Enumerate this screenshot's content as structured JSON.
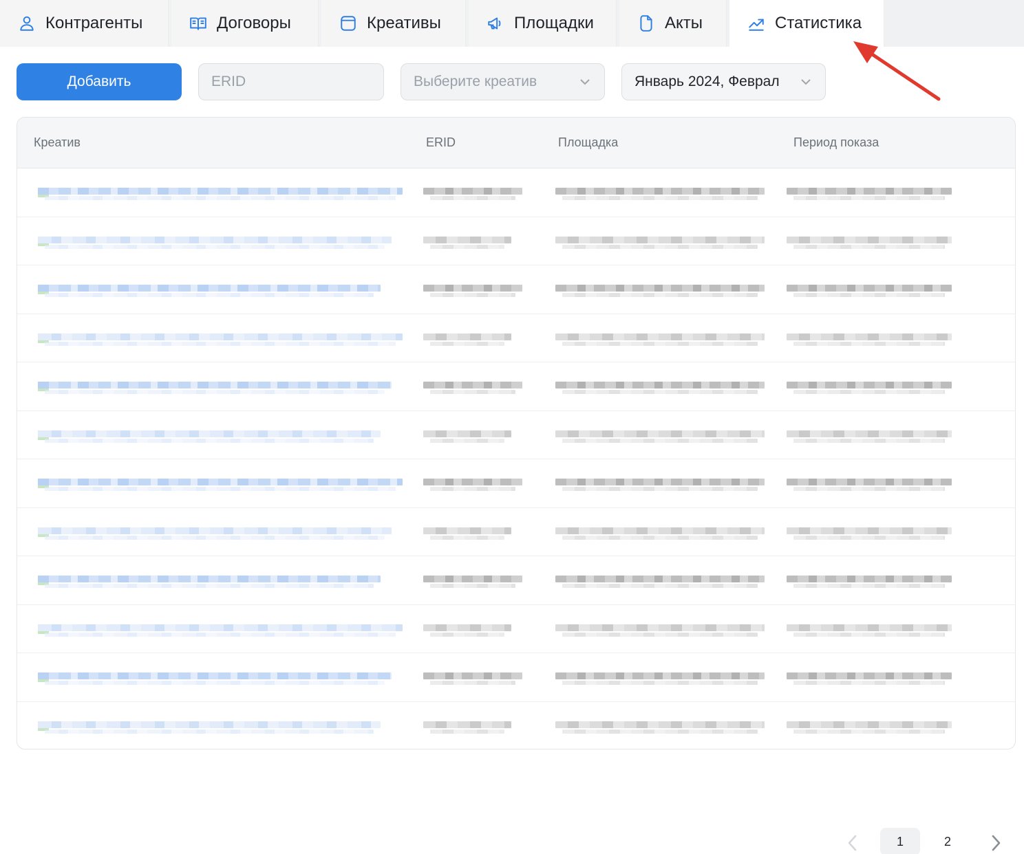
{
  "tabs": [
    {
      "label": "Контрагенты",
      "icon": "user-icon"
    },
    {
      "label": "Договоры",
      "icon": "book-icon"
    },
    {
      "label": "Креативы",
      "icon": "window-icon"
    },
    {
      "label": "Площадки",
      "icon": "megaphone-icon"
    },
    {
      "label": "Акты",
      "icon": "document-icon"
    },
    {
      "label": "Статистика",
      "icon": "trending-up-icon",
      "active": true
    }
  ],
  "toolbar": {
    "add_label": "Добавить",
    "erid_placeholder": "ERID",
    "creative_placeholder": "Выберите креатив",
    "period_value": "Январь 2024, Феврал"
  },
  "table": {
    "headers": [
      "Креатив",
      "ERID",
      "Площадка",
      "Период показа"
    ],
    "row_count": 12
  },
  "pagination": {
    "pages": [
      "1",
      "2"
    ],
    "current": "1"
  },
  "colors": {
    "accent": "#2f81e4",
    "annotation_arrow": "#e03a2f"
  }
}
